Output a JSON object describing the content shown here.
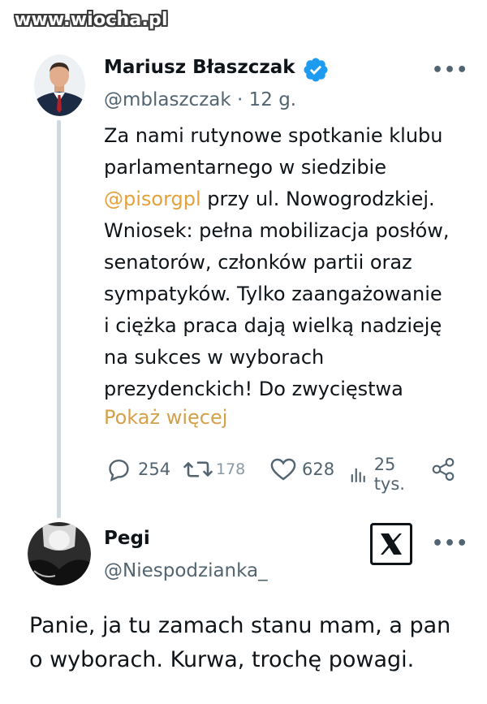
{
  "watermark": "www.wiocha.pl",
  "tweet": {
    "author_name": "Mariusz Błaszczak",
    "handle": "@mblaszczak",
    "time_sep": " · ",
    "time": "12 g.",
    "text_lines": [
      "Za nami rutynowe spotkanie klubu",
      "parlamentarnego w siedzibie",
      [
        "@pisorgpl",
        " przy ul. Nowogrodzkiej."
      ],
      "Wniosek: pełna mobilizacja posłów,",
      "senatorów, członków partii oraz",
      "sympatyków. Tylko zaangażowanie",
      "i ciężka praca dają wielką nadzieję",
      "na sukces w wyborach",
      "prezydenckich! Do zwycięstwa"
    ],
    "show_more": "Pokaż więcej",
    "stats": {
      "replies": "254",
      "reposts": "178",
      "likes": "628",
      "views": "25 tys."
    },
    "more_label": "•••"
  },
  "reply": {
    "author_name": "Pegi",
    "handle": "@Niespodzianka_",
    "text_lines": [
      "Panie, ja tu zamach stanu mam, a pan",
      "o wyborach. Kurwa, trochę powagi."
    ],
    "more_label": "•••"
  },
  "colors": {
    "text": "#0f1419",
    "secondary": "#536471",
    "link": "#e3a23b",
    "verified": "#1d9bf0"
  }
}
